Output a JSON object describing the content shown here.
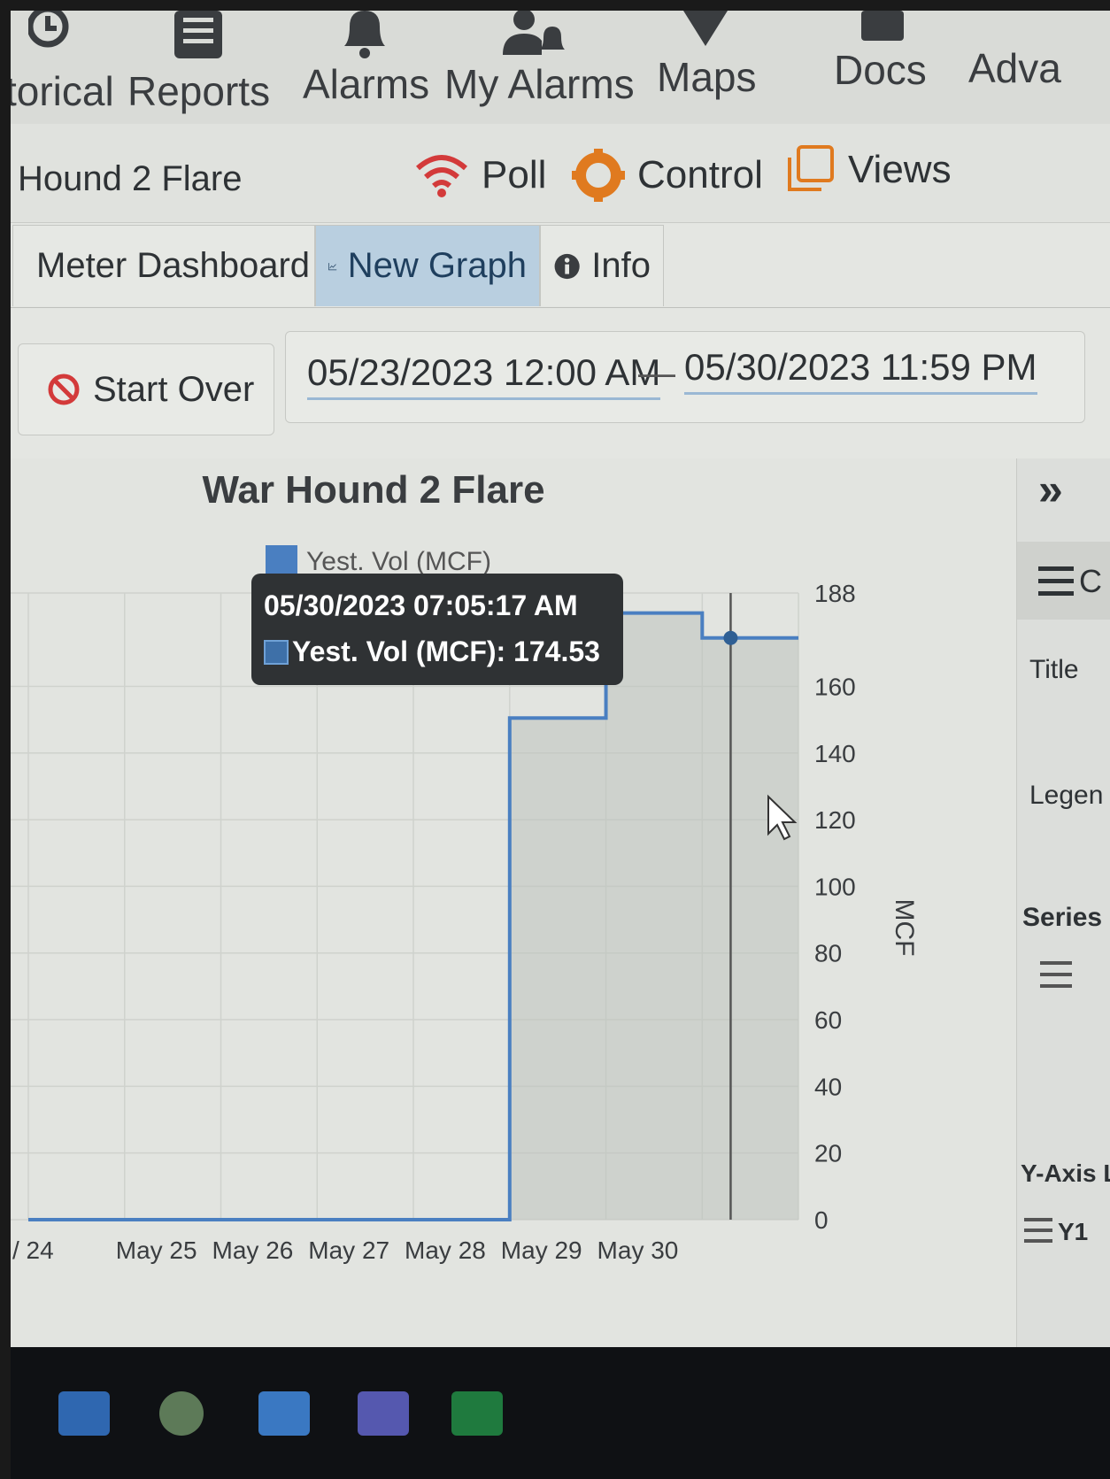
{
  "nav": {
    "items": [
      {
        "label": "torical",
        "icon": "history-icon"
      },
      {
        "label": "Reports",
        "icon": "reports-icon"
      },
      {
        "label": "Alarms",
        "icon": "bell-icon"
      },
      {
        "label": "My Alarms",
        "icon": "user-bell-icon"
      },
      {
        "label": "Maps",
        "icon": "map-pin-icon"
      },
      {
        "label": "Docs",
        "icon": "docs-icon"
      },
      {
        "label": "Adva",
        "icon": ""
      }
    ]
  },
  "meter": {
    "title": "Hound 2 Flare",
    "poll_label": "Poll",
    "control_label": "Control",
    "views_label": "Views"
  },
  "tabs": [
    {
      "label": "Meter Dashboard",
      "active": false
    },
    {
      "label": "New Graph",
      "active": true
    },
    {
      "label": "Info",
      "active": false
    }
  ],
  "controls": {
    "start_over_label": "Start Over",
    "date_from": "05/23/2023 12:00 AM",
    "date_sep": "—",
    "date_to": "05/30/2023 11:59 PM"
  },
  "side_panel": {
    "collapse_label": "»",
    "menu_label": "C",
    "title_label": "Title",
    "legend_label": "Legen",
    "series_label": "Series",
    "yaxis_label": "Y-Axis L",
    "y1_label": "Y1"
  },
  "tooltip": {
    "time": "05/30/2023 07:05:17 AM",
    "value_text": "Yest. Vol (MCF): 174.53"
  },
  "colors": {
    "series": "#4a7fc1",
    "accent_tab": "#b9cfe0",
    "poll_icon": "#d33a3a",
    "control_icon": "#e07a1f",
    "start_over_icon": "#d33a3a"
  },
  "chart_data": {
    "type": "line",
    "title": "War Hound 2 Flare",
    "legend": [
      "Yest. Vol (MCF)"
    ],
    "legend_position": "top-left",
    "ylabel": "MCF",
    "xlabel": "",
    "x_ticks": [
      "/ 24",
      "May 25",
      "May 26",
      "May 27",
      "May 28",
      "May 29",
      "May 30"
    ],
    "y_ticks": [
      0,
      20,
      40,
      60,
      80,
      100,
      120,
      140,
      160,
      188
    ],
    "ylim": [
      0,
      188
    ],
    "grid": true,
    "series": [
      {
        "name": "Yest. Vol (MCF)",
        "step": true,
        "x": [
          "2023-05-23 12:00 AM",
          "2023-05-28 12:00 AM",
          "2023-05-29 12:00 AM",
          "2023-05-30 12:00 AM",
          "2023-05-30 11:59 PM"
        ],
        "y": [
          0,
          150.5,
          182,
          174.53,
          174.53
        ]
      }
    ],
    "highlight": {
      "x": "05/30/2023 07:05:17 AM",
      "y": 174.53
    }
  }
}
